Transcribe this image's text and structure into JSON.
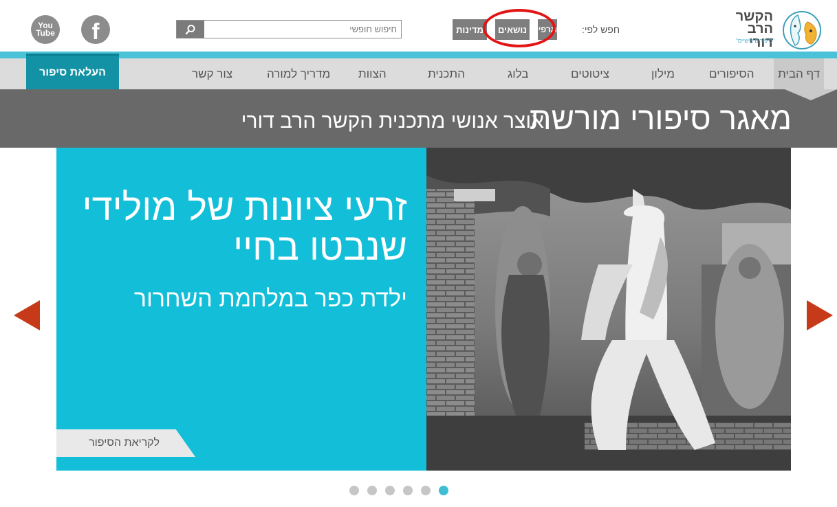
{
  "header": {
    "logo": {
      "line1": "הקשר",
      "line2": "הרב דורי",
      "tagline": "\"סיפורים אישיים\""
    },
    "search_by_label": "חפש לפי:",
    "filters": {
      "people": "ביוגרפיות",
      "topics": "נושאים",
      "countries": "מדינות"
    },
    "search": {
      "placeholder": "חיפוש חופשי",
      "value": ""
    },
    "social": {
      "youtube": "You Tube",
      "facebook": "f"
    }
  },
  "nav": {
    "items": [
      {
        "label": "דף הבית",
        "active": true
      },
      {
        "label": "הסיפורים"
      },
      {
        "label": "מילון"
      },
      {
        "label": "ציטוטים"
      },
      {
        "label": "בלוג"
      },
      {
        "label": "התכנית"
      },
      {
        "label": "הצוות"
      },
      {
        "label": "מדריך למורה"
      },
      {
        "label": "צור קשר"
      }
    ],
    "upload_label": "העלאת סיפור"
  },
  "title_band": {
    "main": "מאגר סיפורי מורשת",
    "sub": "אוצר אנושי מתכנית הקשר הרב דורי"
  },
  "slide": {
    "headline": "זרעי ציונות של מולידי שנבטו בחיי",
    "subhead": "ילדת כפר במלחמת השחרור",
    "read_more": "לקריאת הסיפור"
  },
  "slider": {
    "dot_count": 6,
    "active_dot": 5
  },
  "colors": {
    "accent": "#12bed8",
    "upload": "#1292a4",
    "arrow": "#c63a1a",
    "title_band": "#696969",
    "nav": "#dcdcdc",
    "circle": "#e21414"
  }
}
